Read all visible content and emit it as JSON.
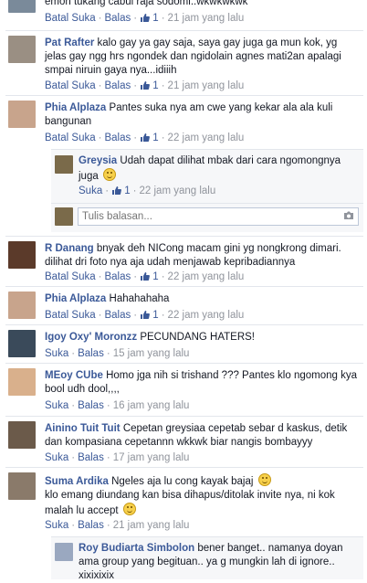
{
  "labels": {
    "unlike": "Batal Suka",
    "like": "Suka",
    "reply": "Balas",
    "separator": "·"
  },
  "top": {
    "text": "emon tukang cabul raja sodomi..wkwkwkwk",
    "like_count": "1",
    "time": "21 jam yang lalu"
  },
  "comments": [
    {
      "name": "Pat Rafter",
      "text": "kalo gay ya gay saja, saya gay juga ga mun kok, yg jelas gay ngg hrs ngondek dan ngidolain agnes mati2an apalagi smpai niruin gaya nya...idiiih",
      "action": "Batal Suka",
      "like_count": "1",
      "time": "21 jam yang lalu",
      "avatar_color": "#9a8f83"
    },
    {
      "name": "Phia Alplaza",
      "text": "Pantes suka nya am cwe yang kekar ala ala kuli bangunan",
      "action": "Batal Suka",
      "like_count": "1",
      "time": "22 jam yang lalu",
      "avatar_color": "#c8a48c"
    },
    {
      "name": "R Danang",
      "text": "bnyak deh NICong macam gini yg nongkrong dimari. dilihat dri foto nya aja udah menjawab kepribadiannya",
      "action": "Batal Suka",
      "like_count": "1",
      "time": "22 jam yang lalu",
      "avatar_color": "#5b3a2a"
    },
    {
      "name": "Phia Alplaza",
      "text": "Hahahahaha",
      "action": "Batal Suka",
      "like_count": "1",
      "time": "22 jam yang lalu",
      "avatar_color": "#c8a48c"
    },
    {
      "name": "Igoy Oxy' Moronzz",
      "text": "PECUNDANG HATERS!",
      "action": "Suka",
      "like_count": "",
      "time": "15 jam yang lalu",
      "avatar_color": "#3a4a5a"
    },
    {
      "name": "MEoy CUbe",
      "text": "Homo jga nih si trishand ??? Pantes klo ngomong kya bool udh dool,,,,",
      "action": "Suka",
      "like_count": "",
      "time": "16 jam yang lalu",
      "avatar_color": "#d9b08c"
    },
    {
      "name": "Ainino Tuit Tuit",
      "text": "Cepetan greysiaa cepetab sebar d kaskus, detik dan kompasiana cepetannn wkkwk biar nangis bombayyy",
      "action": "Suka",
      "like_count": "",
      "time": "17 jam yang lalu",
      "avatar_color": "#6b5a4a"
    },
    {
      "name": "Suma Ardika",
      "text1": "Ngeles aja lu cong kayak bajaj",
      "text2": "klo emang diundang kan bisa dihapus/ditolak invite nya, ni kok malah lu accept",
      "action": "Suka",
      "like_count": "",
      "time": "21 jam yang lalu",
      "avatar_color": "#8a7a6a"
    }
  ],
  "replies": [
    {
      "name": "Greysia",
      "text": "Udah dapat dilihat mbak dari cara ngomongnya juga",
      "action": "Suka",
      "like_count": "1",
      "time": "22 jam yang lalu"
    },
    {
      "name": "Roy Budiarta Simbolon",
      "text": "bener banget.. namanya doyan ama group yang begituan.. ya g mungkin lah di ignore.. xixixixix"
    }
  ],
  "reply_input": {
    "placeholder": "Tulis balasan..."
  },
  "icons": [
    "thumbs-up-icon",
    "camera-icon",
    "smile-emoticon-icon"
  ],
  "colors": {
    "link": "#3b5998",
    "meta": "#90949c",
    "reply_bg": "#f6f7f9"
  }
}
